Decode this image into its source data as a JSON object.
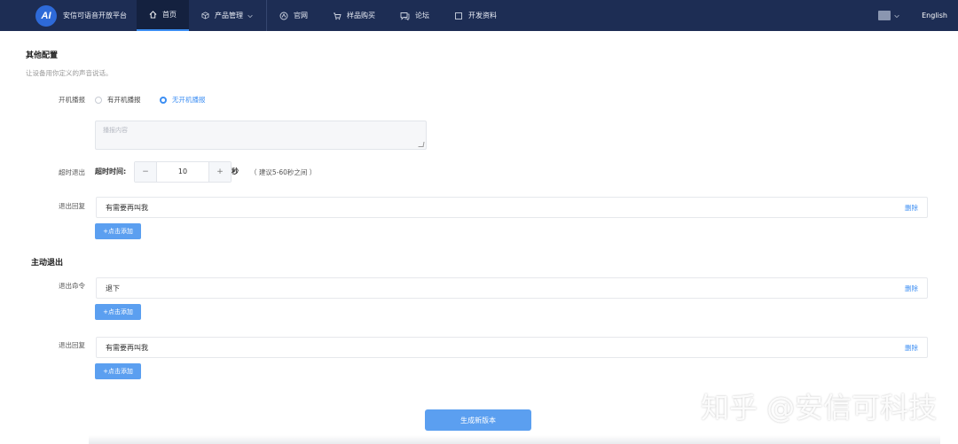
{
  "header": {
    "logo_mark": "AI",
    "logo_text": "安信可语音开放平台",
    "nav": [
      {
        "label": "首页",
        "icon": "home-icon"
      },
      {
        "label": "产品管理",
        "icon": "cube-icon"
      },
      {
        "label": "官网",
        "icon": "globe-icon"
      },
      {
        "label": "样品购买",
        "icon": "cart-icon"
      },
      {
        "label": "论坛",
        "icon": "chat-icon"
      },
      {
        "label": "开发资料",
        "icon": "doc-icon"
      }
    ],
    "language": "English"
  },
  "other_config": {
    "title": "其他配置",
    "description": "让设备用你定义的声音说话。",
    "boot_broadcast": {
      "label": "开机播报",
      "options": [
        "有开机播报",
        "无开机播报"
      ],
      "selected": "无开机播报",
      "placeholder": "播报内容"
    },
    "timeout_exit": {
      "label": "超时退出",
      "time_label": "超时时间:",
      "minus": "−",
      "value": "10",
      "plus": "+",
      "unit": "秒",
      "hint": "（ 建议5-60秒之间 ）"
    },
    "exit_reply": {
      "label": "退出回复",
      "items": [
        "有需要再叫我"
      ],
      "delete_label": "删除",
      "add_label": "+点击添加"
    }
  },
  "active_exit": {
    "title": "主动退出",
    "exit_command": {
      "label": "退出命令",
      "items": [
        "退下"
      ],
      "delete_label": "删除",
      "add_label": "+点击添加"
    },
    "exit_reply": {
      "label": "退出回复",
      "items": [
        "有需要再叫我"
      ],
      "delete_label": "删除",
      "add_label": "+点击添加"
    }
  },
  "generate_button": "生成新版本",
  "watermark": "知乎 @安信可科技",
  "colors": {
    "nav_bg": "#1d2d54",
    "accent": "#3c8ef3",
    "button": "#5b9ff0"
  }
}
